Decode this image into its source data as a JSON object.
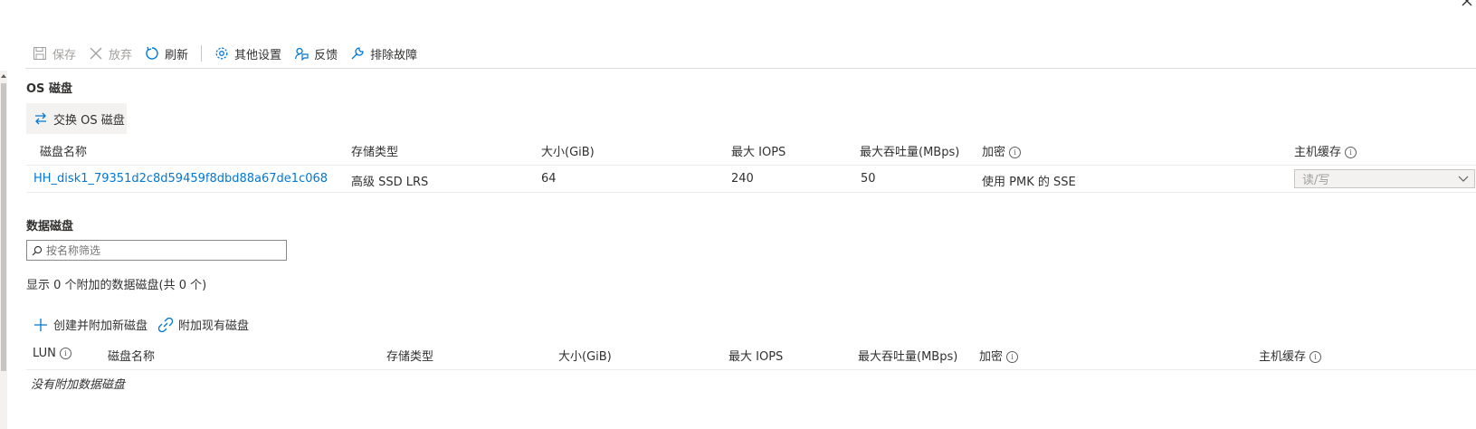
{
  "toolbar": {
    "save": "保存",
    "discard": "放弃",
    "refresh": "刷新",
    "other_settings": "其他设置",
    "feedback": "反馈",
    "troubleshoot": "排除故障"
  },
  "os_disk": {
    "section_title": "OS 磁盘",
    "swap_button": "交换 OS 磁盘",
    "columns": {
      "name": "磁盘名称",
      "storage_type": "存储类型",
      "size": "大小(GiB)",
      "max_iops": "最大 IOPS",
      "max_throughput": "最大吞吐量(MBps)",
      "encryption": "加密",
      "host_caching": "主机缓存"
    },
    "row": {
      "name": "HH_disk1_79351d2c8d59459f8dbd88a67de1c068",
      "storage_type": "高级 SSD LRS",
      "size": "64",
      "max_iops": "240",
      "max_throughput": "50",
      "encryption": "使用 PMK 的 SSE",
      "host_caching": "读/写"
    }
  },
  "data_disks": {
    "section_title": "数据磁盘",
    "filter_placeholder": "按名称筛选",
    "summary": "显示 0 个附加的数据磁盘(共 0 个)",
    "create_attach": "创建并附加新磁盘",
    "attach_existing": "附加现有磁盘",
    "columns": {
      "lun": "LUN",
      "name": "磁盘名称",
      "storage_type": "存储类型",
      "size": "大小(GiB)",
      "max_iops": "最大 IOPS",
      "max_throughput": "最大吞吐量(MBps)",
      "encryption": "加密",
      "host_caching": "主机缓存"
    },
    "empty_text": "没有附加数据磁盘"
  },
  "colors": {
    "accent": "#0078d4",
    "text": "#323130",
    "disabled": "#a19f9d",
    "border": "#edebe9"
  }
}
